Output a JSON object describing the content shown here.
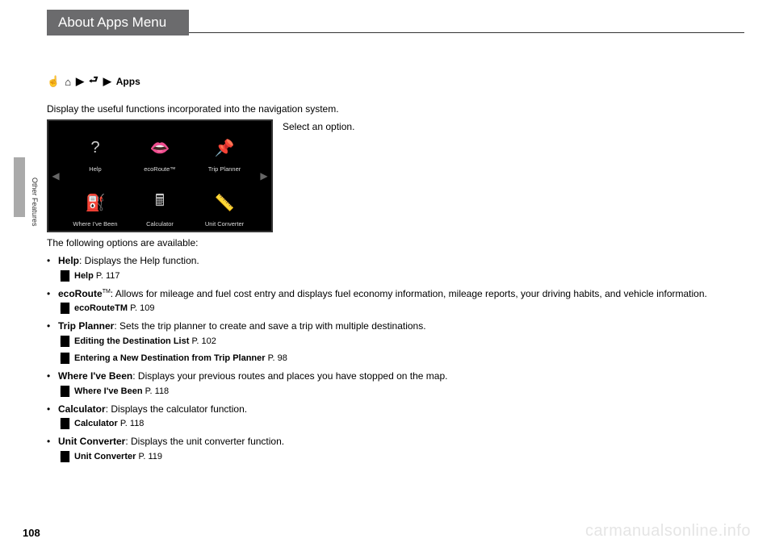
{
  "header": {
    "title": "About Apps Menu"
  },
  "sidebar": {
    "label": "Other Features"
  },
  "breadcrumb": {
    "apps": "Apps"
  },
  "intro": "Display the useful functions incorporated into the navigation system.",
  "instruction": "Select an option.",
  "apps_grid": {
    "cells": [
      {
        "label": "Help",
        "icon": "?"
      },
      {
        "label": "ecoRoute™",
        "icon": "👄"
      },
      {
        "label": "Trip Planner",
        "icon": "📌"
      },
      {
        "label": "Where I've Been",
        "icon": "⛽"
      },
      {
        "label": "Calculator",
        "icon": "🖩"
      },
      {
        "label": "Unit Converter",
        "icon": "📏"
      }
    ]
  },
  "options_intro": "The following options are available:",
  "options": [
    {
      "title": "Help",
      "desc": ": Displays the Help function.",
      "xrefs": [
        {
          "label": "Help",
          "page": "P. 117"
        }
      ]
    },
    {
      "title": "ecoRoute",
      "tm": "TM",
      "desc": ": Allows for mileage and fuel cost entry and displays fuel economy information, mileage reports, your driving habits, and vehicle information.",
      "xrefs": [
        {
          "label": "ecoRouteTM",
          "page": "P. 109"
        }
      ]
    },
    {
      "title": "Trip Planner",
      "desc": ": Sets the trip planner to create and save a trip with multiple destinations.",
      "xrefs": [
        {
          "label": "Editing the Destination List",
          "page": "P. 102"
        },
        {
          "label": "Entering a New Destination from Trip Planner",
          "page": "P. 98"
        }
      ]
    },
    {
      "title": "Where I've Been",
      "desc": ": Displays your previous routes and places you have stopped on the map.",
      "xrefs": [
        {
          "label": "Where I've Been",
          "page": "P. 118"
        }
      ]
    },
    {
      "title": "Calculator",
      "desc": ": Displays the calculator function.",
      "xrefs": [
        {
          "label": "Calculator",
          "page": "P. 118"
        }
      ]
    },
    {
      "title": "Unit Converter",
      "desc": ": Displays the unit converter function.",
      "xrefs": [
        {
          "label": "Unit Converter",
          "page": "P. 119"
        }
      ]
    }
  ],
  "page_number": "108",
  "watermark": "carmanualsonline.info"
}
